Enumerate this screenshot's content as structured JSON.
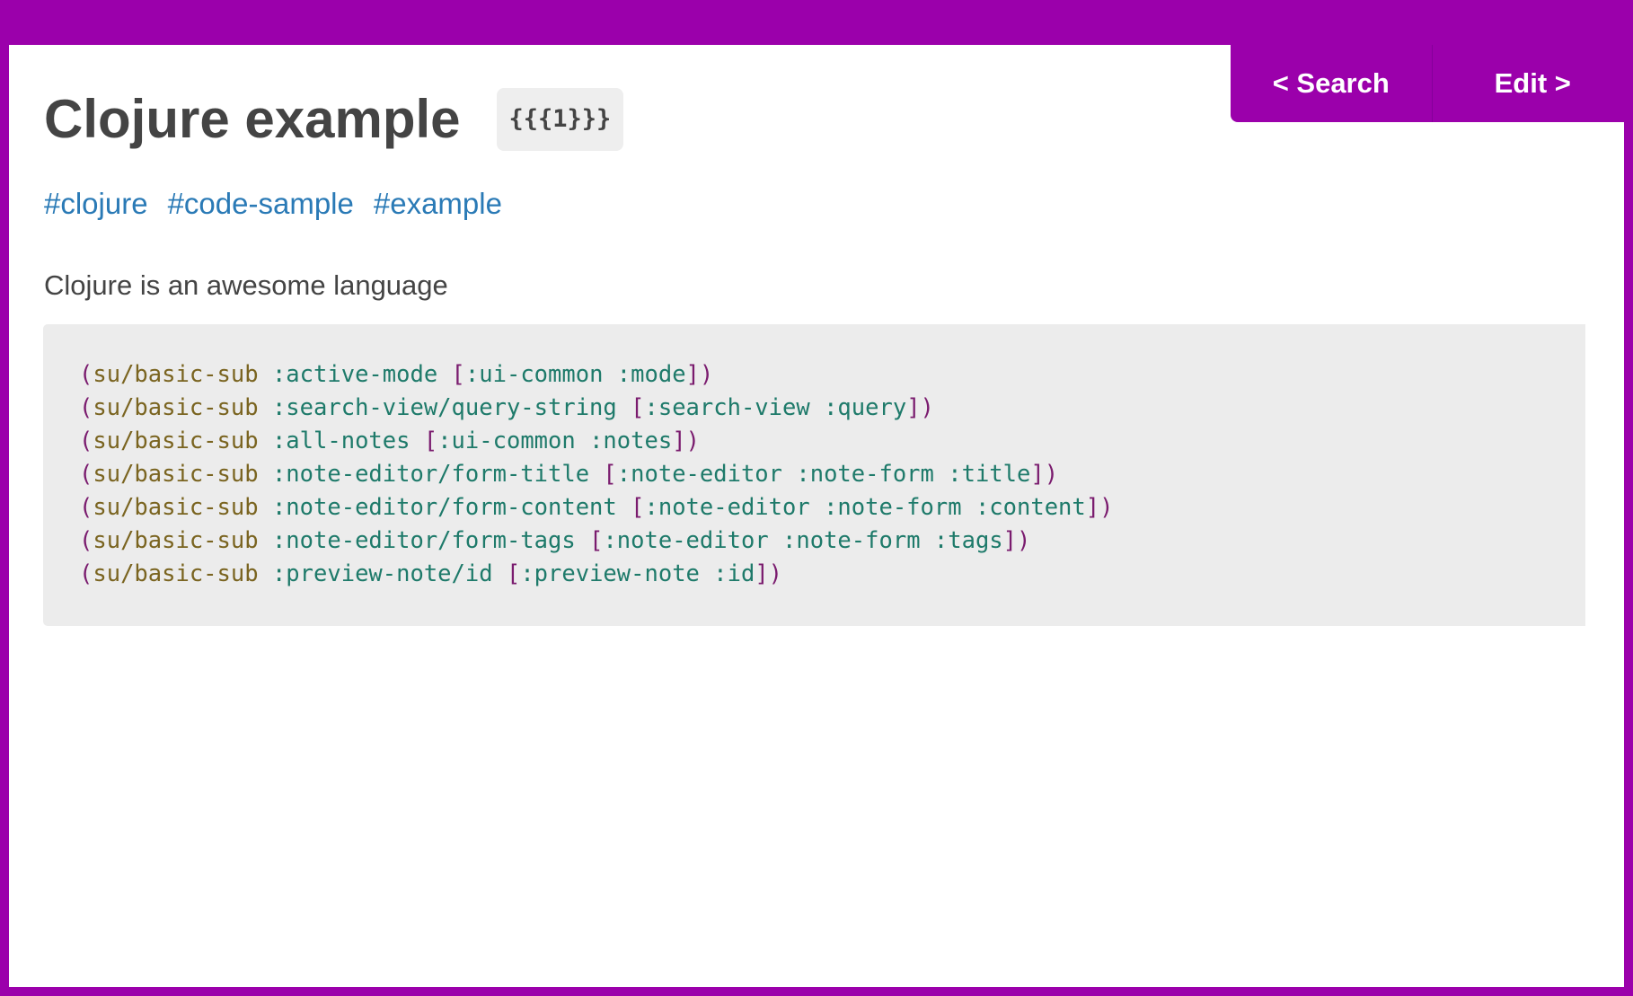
{
  "nav": {
    "search_label": "< Search",
    "edit_label": "Edit >"
  },
  "note": {
    "title": "Clojure example",
    "id_badge": "{{{1}}}",
    "tags": [
      "#clojure",
      "#code-sample",
      "#example"
    ],
    "description": "Clojure is an awesome language"
  },
  "code": {
    "lines": [
      {
        "fn": "su/basic-sub",
        "key": ":active-mode",
        "args": ":ui-common :mode"
      },
      {
        "fn": "su/basic-sub",
        "key": ":search-view/query-string",
        "args": ":search-view :query"
      },
      {
        "fn": "su/basic-sub",
        "key": ":all-notes",
        "args": ":ui-common :notes"
      },
      {
        "fn": "su/basic-sub",
        "key": ":note-editor/form-title",
        "args": ":note-editor :note-form :title"
      },
      {
        "fn": "su/basic-sub",
        "key": ":note-editor/form-content",
        "args": ":note-editor :note-form :content"
      },
      {
        "fn": "su/basic-sub",
        "key": ":note-editor/form-tags",
        "args": ":note-editor :note-form :tags"
      },
      {
        "fn": "su/basic-sub",
        "key": ":preview-note/id",
        "args": ":preview-note :id"
      }
    ]
  },
  "colors": {
    "frame": "#9b00ab",
    "tag_link": "#2a7ab6",
    "code_paren": "#7a1b6e",
    "code_fn": "#7a6420",
    "code_keyword": "#1e7a6a",
    "code_background": "#ececec"
  }
}
